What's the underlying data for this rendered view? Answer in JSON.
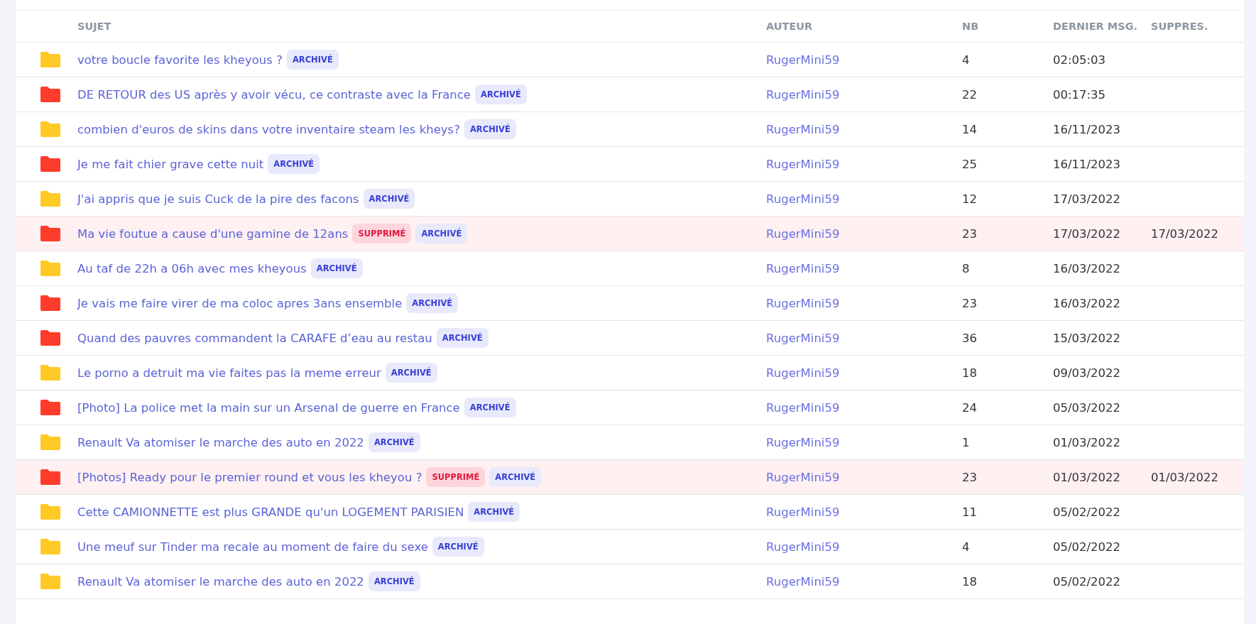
{
  "table": {
    "columns": [
      "SUJET",
      "AUTEUR",
      "NB",
      "DERNIER MSG.",
      "SUPPRES."
    ],
    "rows": [
      {
        "color": "#ffc926",
        "subject": "votre boucle favorite les kheyous ?",
        "deleted": false,
        "tags": [
          {
            "kind": "archived",
            "label": "ARCHIVÉ"
          }
        ],
        "author": "RugerMini59",
        "count": "4",
        "last": "02:05:03"
      },
      {
        "color": "#ff3b2a",
        "subject": "DE RETOUR des US après y avoir vécu, ce contraste avec la France",
        "deleted": false,
        "tags": [
          {
            "kind": "archived",
            "label": "ARCHIVÉ"
          }
        ],
        "author": "RugerMini59",
        "count": "22",
        "last": "00:17:35"
      },
      {
        "color": "#ffc926",
        "subject": "combien d'euros de skins dans votre inventaire steam les kheys?",
        "deleted": false,
        "tags": [
          {
            "kind": "archived",
            "label": "ARCHIVÉ"
          }
        ],
        "author": "RugerMini59",
        "count": "14",
        "last": "16/11/2023"
      },
      {
        "color": "#ff3b2a",
        "subject": "Je me fait chier grave cette nuit",
        "deleted": false,
        "tags": [
          {
            "kind": "archived",
            "label": "ARCHIVÉ"
          }
        ],
        "author": "RugerMini59",
        "count": "25",
        "last": "16/11/2023"
      },
      {
        "color": "#ffc926",
        "subject": "J'ai appris que je suis Cuck de la pire des facons",
        "deleted": false,
        "tags": [
          {
            "kind": "archived",
            "label": "ARCHIVÉ"
          }
        ],
        "author": "RugerMini59",
        "count": "12",
        "last": "17/03/2022"
      },
      {
        "color": "#ff3b2a",
        "subject": "Ma vie foutue a cause d'une gamine de 12ans",
        "deleted": true,
        "tags": [
          {
            "kind": "deleted",
            "label": "SUPPRIMÉ"
          },
          {
            "kind": "archived",
            "label": "ARCHIVÉ"
          }
        ],
        "author": "RugerMini59",
        "count": "23",
        "last": "17/03/2022",
        "deleted_on": "17/03/2022"
      },
      {
        "color": "#ffc926",
        "subject": "Au taf de 22h a 06h avec mes kheyous",
        "deleted": false,
        "tags": [
          {
            "kind": "archived",
            "label": "ARCHIVÉ"
          }
        ],
        "author": "RugerMini59",
        "count": "8",
        "last": "16/03/2022"
      },
      {
        "color": "#ff3b2a",
        "subject": "Je vais me faire virer de ma coloc apres 3ans ensemble",
        "deleted": false,
        "tags": [
          {
            "kind": "archived",
            "label": "ARCHIVÉ"
          }
        ],
        "author": "RugerMini59",
        "count": "23",
        "last": "16/03/2022"
      },
      {
        "color": "#ff3b2a",
        "subject": "Quand des pauvres commandent la CARAFE d’eau au restau",
        "deleted": false,
        "tags": [
          {
            "kind": "archived",
            "label": "ARCHIVÉ"
          }
        ],
        "author": "RugerMini59",
        "count": "36",
        "last": "15/03/2022"
      },
      {
        "color": "#ffc926",
        "subject": "Le porno a detruit ma vie faites pas la meme erreur",
        "deleted": false,
        "tags": [
          {
            "kind": "archived",
            "label": "ARCHIVÉ"
          }
        ],
        "author": "RugerMini59",
        "count": "18",
        "last": "09/03/2022"
      },
      {
        "color": "#ff3b2a",
        "subject": "[Photo] La police met la main sur un Arsenal de guerre en France",
        "deleted": false,
        "tags": [
          {
            "kind": "archived",
            "label": "ARCHIVÉ"
          }
        ],
        "author": "RugerMini59",
        "count": "24",
        "last": "05/03/2022"
      },
      {
        "color": "#ffc926",
        "subject": "Renault Va atomiser le marche des auto en 2022",
        "deleted": false,
        "tags": [
          {
            "kind": "archived",
            "label": "ARCHIVÉ"
          }
        ],
        "author": "RugerMini59",
        "count": "1",
        "last": "01/03/2022"
      },
      {
        "color": "#ff3b2a",
        "subject": "[Photos] Ready pour le premier round et vous les kheyou ?",
        "deleted": true,
        "tags": [
          {
            "kind": "deleted",
            "label": "SUPPRIMÉ"
          },
          {
            "kind": "archived",
            "label": "ARCHIVÉ"
          }
        ],
        "author": "RugerMini59",
        "count": "23",
        "last": "01/03/2022",
        "deleted_on": "01/03/2022"
      },
      {
        "color": "#ffc926",
        "subject": "Cette CAMIONNETTE est plus GRANDE qu'un LOGEMENT PARISIEN",
        "deleted": false,
        "tags": [
          {
            "kind": "archived",
            "label": "ARCHIVÉ"
          }
        ],
        "author": "RugerMini59",
        "count": "11",
        "last": "05/02/2022"
      },
      {
        "color": "#ffc926",
        "subject": "Une meuf sur Tinder ma recale au moment de faire du sexe",
        "deleted": false,
        "tags": [
          {
            "kind": "archived",
            "label": "ARCHIVÉ"
          }
        ],
        "author": "RugerMini59",
        "count": "4",
        "last": "05/02/2022"
      },
      {
        "color": "#ffc926",
        "subject": "Renault Va atomiser le marche des auto en 2022",
        "deleted": false,
        "tags": [
          {
            "kind": "archived",
            "label": "ARCHIVÉ"
          }
        ],
        "author": "RugerMini59",
        "count": "18",
        "last": "05/02/2022"
      }
    ]
  }
}
